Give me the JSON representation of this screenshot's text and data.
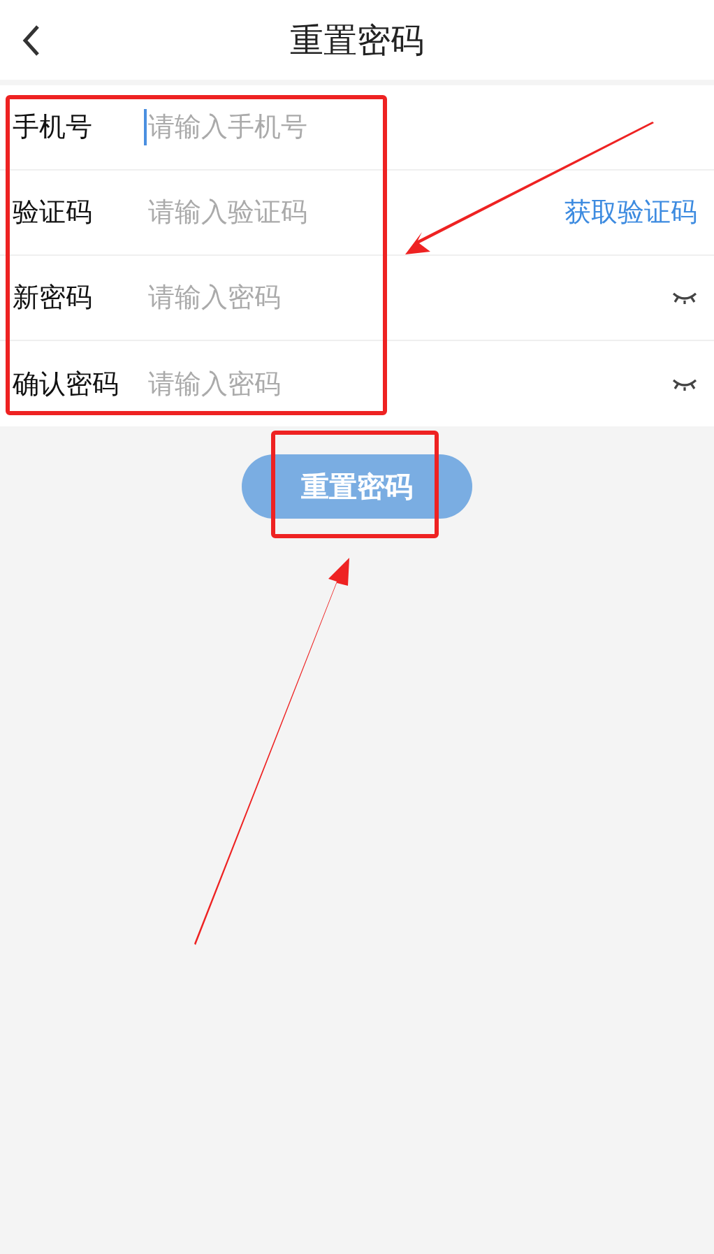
{
  "header": {
    "title": "重置密码"
  },
  "fields": [
    {
      "kind": "text",
      "label": "手机号",
      "placeholder": "请输入手机号",
      "focused": true
    },
    {
      "kind": "code",
      "label": "验证码",
      "placeholder": "请输入验证码",
      "action": "获取验证码",
      "focused": false
    },
    {
      "kind": "password",
      "label": "新密码",
      "placeholder": "请输入密码",
      "focused": false
    },
    {
      "kind": "password",
      "label": "确认密码",
      "placeholder": "请输入密码",
      "focused": false
    }
  ],
  "submit_button": {
    "label": "重置密码"
  },
  "annotations": [
    {
      "kind": "box"
    },
    {
      "kind": "box"
    },
    {
      "kind": "arrow"
    },
    {
      "kind": "arrow"
    }
  ]
}
